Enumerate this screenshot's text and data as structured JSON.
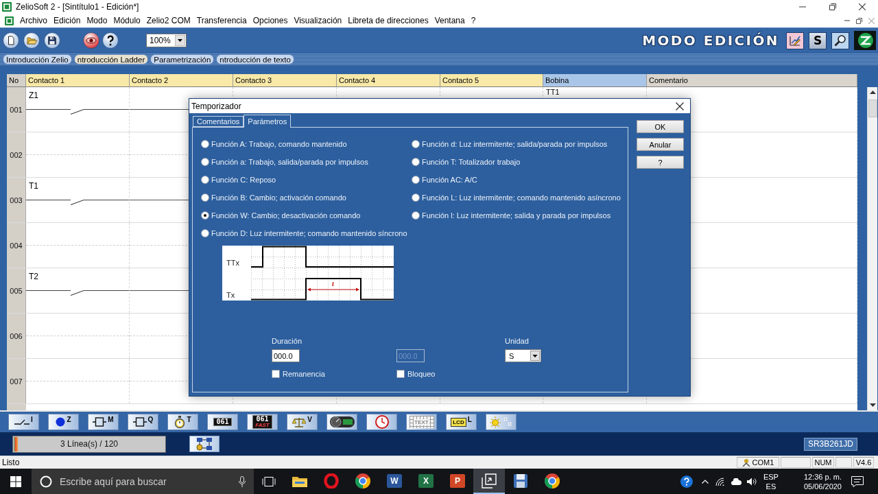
{
  "window": {
    "title": "ZelioSoft 2 - [Sintítulo1 - Edición*]"
  },
  "menu": [
    "Archivo",
    "Edición",
    "Modo",
    "Módulo",
    "Zelio2 COM",
    "Transferencia",
    "Opciones",
    "Visualización",
    "Libreta de direcciones",
    "Ventana",
    "?"
  ],
  "toolbar": {
    "zoom": "100%",
    "mode": "MODO EDICIÓN",
    "mode_buttons": [
      {
        "kind": "edit"
      },
      {
        "kind": "letter",
        "label": "S"
      },
      {
        "kind": "search"
      },
      {
        "kind": "logo"
      }
    ]
  },
  "tabs": [
    {
      "label": "Introducción Zelio",
      "selected": false
    },
    {
      "label": "ntroducción Ladder",
      "selected": true
    },
    {
      "label": "Parametrización",
      "selected": false
    },
    {
      "label": "ntroducción de texto",
      "selected": false
    }
  ],
  "ladder": {
    "columns": [
      {
        "label": "No",
        "kind": "number"
      },
      {
        "label": "Contacto 1",
        "kind": "contact"
      },
      {
        "label": "Contacto 2",
        "kind": "contact"
      },
      {
        "label": "Contacto 3",
        "kind": "contact"
      },
      {
        "label": "Contacto 4",
        "kind": "contact"
      },
      {
        "label": "Contacto 5",
        "kind": "contact"
      },
      {
        "label": "Bobina",
        "kind": "coil"
      },
      {
        "label": "Comentario",
        "kind": "comment"
      }
    ],
    "rows": [
      {
        "number": "001",
        "contact": "Z1",
        "coil": "TT1"
      },
      {
        "number": "002"
      },
      {
        "number": "003",
        "contact": "T1"
      },
      {
        "number": "004"
      },
      {
        "number": "005",
        "contact": "T2"
      },
      {
        "number": "006"
      },
      {
        "number": "007"
      }
    ]
  },
  "dialog": {
    "title": "Temporizador",
    "tabs": [
      {
        "label": "Comentarios",
        "selected": false
      },
      {
        "label": "Parámetros",
        "selected": true
      }
    ],
    "functions": {
      "left": [
        {
          "label": "Función A: Trabajo, comando mantenido",
          "selected": false
        },
        {
          "label": "Función a: Trabajo, salida/parada por impulsos",
          "selected": false
        },
        {
          "label": "Función C: Reposo",
          "selected": false
        },
        {
          "label": "Función B: Cambio; activación comando",
          "selected": false
        },
        {
          "label": "Función W: Cambio; desactivación comando",
          "selected": true
        },
        {
          "label": "Función D: Luz intermitente; comando mantenido síncrono",
          "selected": false
        }
      ],
      "right": [
        {
          "label": "Función d: Luz intermitente; salida/parada por impulsos",
          "selected": false
        },
        {
          "label": "Función T: Totalizador trabajo",
          "selected": false
        },
        {
          "label": "Función AC: A/C",
          "selected": false
        },
        {
          "label": "Función L: Luz intermitente; comando mantenido asíncrono",
          "selected": false
        },
        {
          "label": "Función l: Luz intermitente; salida y parada por impulsos",
          "selected": false
        }
      ]
    },
    "diagram": {
      "signals": [
        "TTx",
        "Tx"
      ],
      "interval": "t"
    },
    "fields": [
      {
        "kind": "input",
        "label": "Duración",
        "value": "000.0",
        "disabled": false
      },
      {
        "kind": "input",
        "value": "000.0",
        "disabled": true
      },
      {
        "kind": "select",
        "label": "Unidad",
        "value": "S"
      }
    ],
    "checkboxes": [
      {
        "label": "Remanencia",
        "checked": false
      },
      {
        "label": "Bloqueo",
        "checked": false
      }
    ],
    "buttons": [
      "OK",
      "Anular",
      "?"
    ]
  },
  "palette": [
    {
      "kind": "contact",
      "label": "I"
    },
    {
      "kind": "coil",
      "label": "Z"
    },
    {
      "kind": "relay",
      "label": "M"
    },
    {
      "kind": "relay",
      "label": "Q"
    },
    {
      "kind": "timer",
      "label": "T"
    },
    {
      "kind": "counter",
      "label": "061"
    },
    {
      "kind": "counter",
      "label": "061",
      "note": "FAST"
    },
    {
      "kind": "scale",
      "label": "V"
    },
    {
      "kind": "gauge"
    },
    {
      "kind": "clock"
    },
    {
      "kind": "grid",
      "label": "TEXT"
    },
    {
      "kind": "lcd",
      "label": "LCD",
      "note": "L"
    },
    {
      "kind": "sun"
    }
  ],
  "lines": {
    "label": "3 Línea(s) / 120",
    "level": 0.025
  },
  "module": "SR3B261JD",
  "status_bar": {
    "text": "Listo",
    "panes": [
      {
        "kind": "port",
        "label": "COM1"
      },
      {
        "kind": "blank"
      },
      {
        "kind": "text",
        "label": "NUM"
      },
      {
        "kind": "blank"
      },
      {
        "kind": "text",
        "label": "V4.6"
      }
    ]
  },
  "taskbar": {
    "search": {
      "placeholder": "Escribe aquí para buscar"
    },
    "apps": [
      {
        "kind": "folder",
        "selected": false
      },
      {
        "kind": "ring",
        "selected": false
      },
      {
        "kind": "browser",
        "selected": false
      },
      {
        "kind": "letter",
        "letter": "W",
        "color": "#2b579a",
        "selected": false
      },
      {
        "kind": "letter",
        "letter": "X",
        "color": "#217346",
        "selected": false
      },
      {
        "kind": "letter",
        "letter": "P",
        "color": "#d24726",
        "selected": false
      },
      {
        "kind": "transfer",
        "selected": true
      },
      {
        "kind": "disk",
        "selected": false
      },
      {
        "kind": "browser",
        "selected": false
      }
    ],
    "tray": {
      "language": "ESP",
      "layout": "ES",
      "time": "12:36 p. m.",
      "date": "05/06/2020"
    }
  }
}
